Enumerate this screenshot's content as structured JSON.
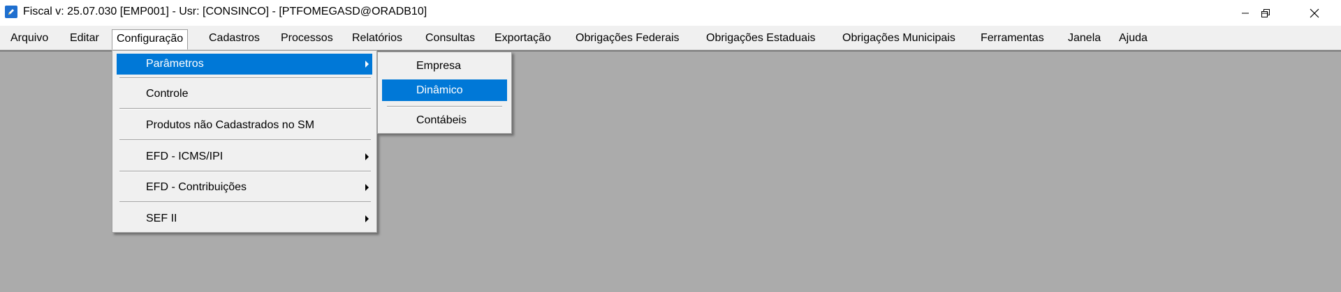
{
  "window": {
    "title": "Fiscal  v: 25.07.030   [EMP001] - Usr: [CONSINCO] - [PTFOMEGASD@ORADB10]"
  },
  "menubar": {
    "items": [
      "Arquivo",
      "Editar",
      "Configuração",
      "Cadastros",
      "Processos",
      "Relatórios",
      "Consultas",
      "Exportação",
      "Obrigações Federais",
      "Obrigações Estaduais",
      "Obrigações Municipais",
      "Ferramentas",
      "Janela",
      "Ajuda"
    ],
    "open_item": "Configuração"
  },
  "config_menu": {
    "items": [
      {
        "label": "Parâmetros",
        "has_submenu": true,
        "highlighted": true
      },
      {
        "label": "Controle",
        "has_submenu": false
      },
      {
        "label": "Produtos não Cadastrados no SM",
        "has_submenu": false
      },
      {
        "label": "EFD - ICMS/IPI",
        "has_submenu": true
      },
      {
        "label": "EFD - Contribuições",
        "has_submenu": true
      },
      {
        "label": "SEF II",
        "has_submenu": true
      }
    ]
  },
  "parametros_submenu": {
    "items": [
      {
        "label": "Empresa"
      },
      {
        "label": "Dinâmico",
        "highlighted": true
      },
      {
        "label": "Contábeis"
      }
    ]
  },
  "colors": {
    "highlight": "#0078d7",
    "desktop": "#ababab",
    "menu_bg": "#f0f0f0"
  },
  "icons": {
    "app": "pencil-icon",
    "minimize": "minimize-icon",
    "restore": "restore-icon",
    "close": "close-icon",
    "submenu_arrow": "chevron-right-icon"
  }
}
